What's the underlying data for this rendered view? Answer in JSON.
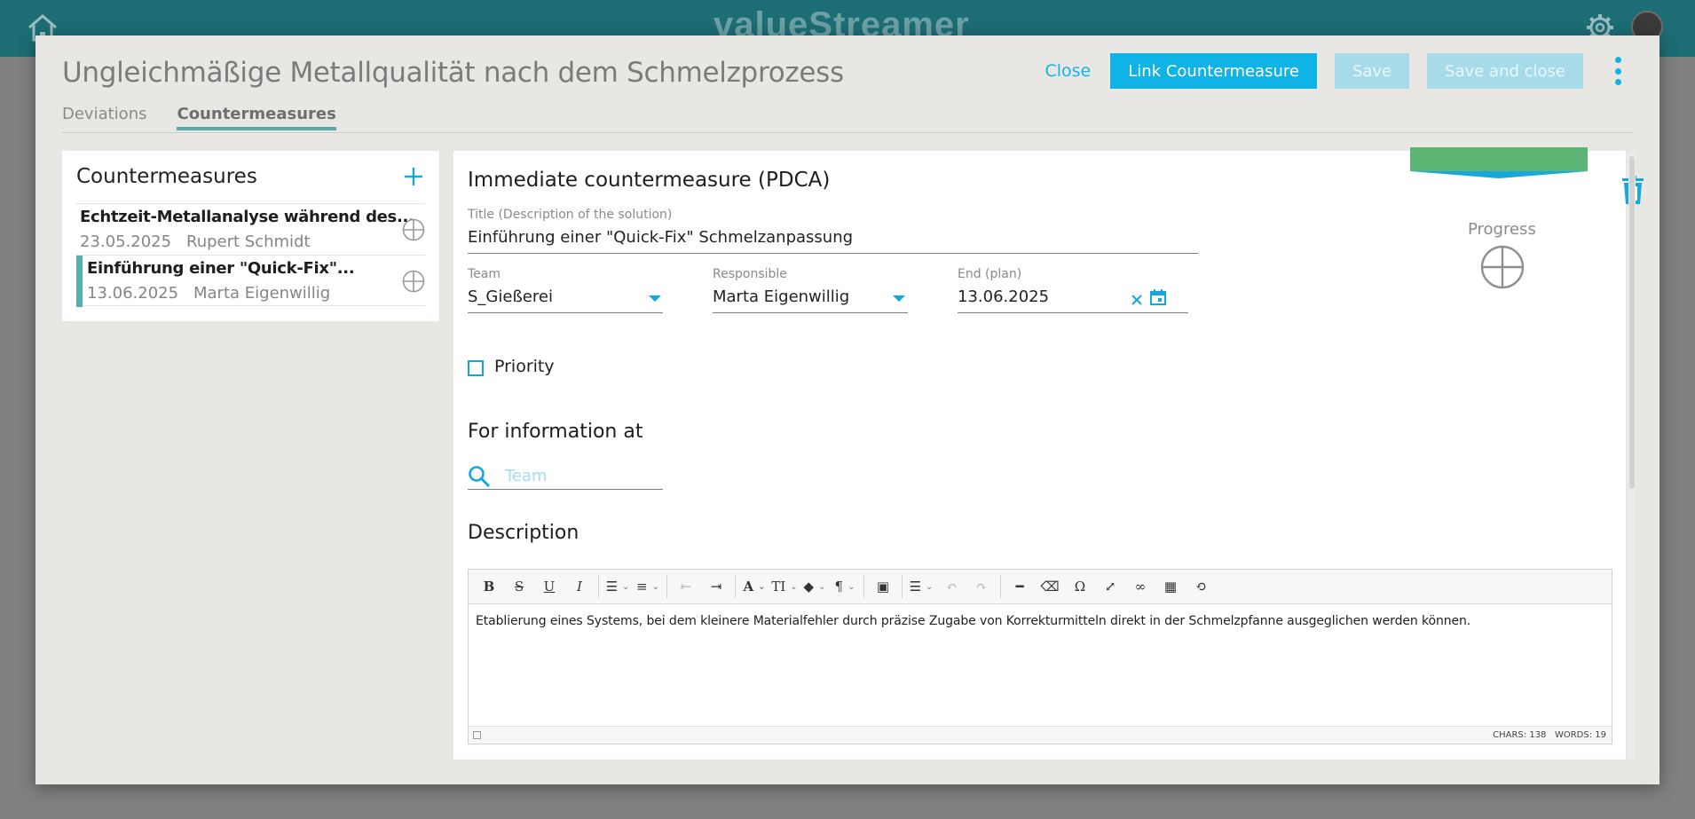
{
  "app": {
    "brand": "valueStreamer"
  },
  "modal": {
    "title": "Ungleichmäßige Metallqualität nach dem Schmelzprozess",
    "close_label": "Close",
    "link_label": "Link Countermeasure",
    "save_label": "Save",
    "save_close_label": "Save and close",
    "tabs": [
      {
        "label": "Deviations",
        "active": false
      },
      {
        "label": "Countermeasures",
        "active": true
      }
    ]
  },
  "list": {
    "title": "Countermeasures",
    "items": [
      {
        "name": "Echtzeit-Metallanalyse während des...",
        "date": "23.05.2025",
        "person": "Rupert Schmidt",
        "selected": false
      },
      {
        "name": "Einführung einer \"Quick-Fix\"...",
        "date": "13.06.2025",
        "person": "Marta Eigenwillig",
        "selected": true
      }
    ]
  },
  "detail": {
    "heading": "Immediate countermeasure (PDCA)",
    "title_label": "Title (Description of the solution)",
    "title_value": "Einführung einer \"Quick-Fix\" Schmelzanpassung",
    "team_label": "Team",
    "team_value": "S_Gießerei",
    "responsible_label": "Responsible",
    "responsible_value": "Marta Eigenwillig",
    "end_label": "End (plan)",
    "end_value": "13.06.2025",
    "priority_label": "Priority",
    "priority_checked": false,
    "info_heading": "For information at",
    "info_placeholder": "Team",
    "description_heading": "Description",
    "description_text": "Etablierung eines Systems, bei dem kleinere Materialfehler durch präzise Zugabe von Korrekturmitteln direkt in der Schmelzpfanne ausgeglichen werden können.",
    "chars_label": "CHARS: 138",
    "words_label": "WORDS: 19",
    "progress_label": "Progress",
    "progress_quadrants_filled": 0
  },
  "colors": {
    "accent": "#10b3e5",
    "accent_disabled": "#a8dbe9",
    "header_teal": "#1d6d74",
    "selection_bar": "#53b0ad",
    "status_green": "#5cb574"
  },
  "icons": {
    "home": "home-icon",
    "gear": "gear-icon",
    "add": "plus-icon",
    "pdca": "pdca-quadrant-icon",
    "trash": "trash-icon",
    "calendar": "calendar-icon",
    "clear": "close-icon",
    "search": "search-icon",
    "more": "kebab-icon"
  }
}
